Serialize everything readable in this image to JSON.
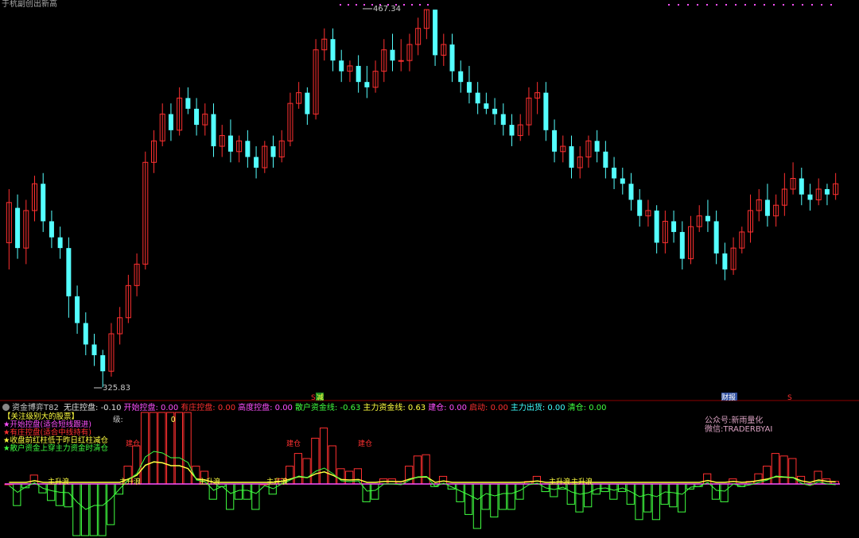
{
  "window": {
    "title": "于杭副创出新高"
  },
  "price_labels": {
    "high": "467.34",
    "low": "325.83"
  },
  "markers": {
    "jian": "减",
    "s1": "S",
    "s2": "S",
    "caibao": "财报"
  },
  "indicator": {
    "name": "资金博弈T82",
    "items": [
      {
        "label": "无庄控盘:",
        "value": "-0.10",
        "color": "#e0e0e0"
      },
      {
        "label": "开始控盘:",
        "value": "0.00",
        "color": "#ff50ff"
      },
      {
        "label": "有庄控盘:",
        "value": "0.00",
        "color": "#ff3030"
      },
      {
        "label": "高度控盘:",
        "value": "0.00",
        "color": "#ff50ff"
      },
      {
        "label": "散户资金线:",
        "value": "-0.63",
        "color": "#40ff40"
      },
      {
        "label": "主力资金线:",
        "value": "0.63",
        "color": "#ffff40"
      },
      {
        "label": "建仓:",
        "value": "0.00",
        "color": "#ff50ff"
      },
      {
        "label": "启动:",
        "value": "0.00",
        "color": "#ff3030"
      },
      {
        "label": "主力出货:",
        "value": "0.00",
        "color": "#40ffff"
      },
      {
        "label": "清仓:",
        "value": "0.00",
        "color": "#40ff40"
      }
    ]
  },
  "legend": [
    {
      "text": "【关注级别大的股票】",
      "color": "#ffff40"
    },
    {
      "text": "★开始控盘(适合短线跟进)",
      "color": "#ff50ff"
    },
    {
      "text": "★有庄控盘(适合中线持有)",
      "color": "#ff3030"
    },
    {
      "text": "★收盘前红柱低于昨日红柱减仓",
      "color": "#ffff40"
    },
    {
      "text": "★散户资金上穿主力资金时清仓",
      "color": "#40ff40"
    }
  ],
  "ji": {
    "label": "级:",
    "value": "0"
  },
  "watermark": {
    "line1": "公众号:新雨量化",
    "line2": "微信:TRADERBYAI"
  },
  "signals": {
    "zsj": "主升浪",
    "jc": "建仓"
  },
  "colors": {
    "up": "#ff3030",
    "down": "#54ffff",
    "vol_up": "#ff3030",
    "vol_down": "#40ff40",
    "main_line": "#ffff40",
    "retail_line": "#40ff40",
    "level_line": "#ff50ff"
  },
  "chart_data": {
    "type": "candlestick",
    "title": "",
    "ylim": [
      325.83,
      467.34
    ],
    "candles": [
      [
        380,
        395,
        370,
        400
      ],
      [
        393,
        378,
        374,
        398
      ],
      [
        378,
        392,
        372,
        396
      ],
      [
        392,
        402,
        388,
        405
      ],
      [
        402,
        388,
        384,
        406
      ],
      [
        388,
        382,
        378,
        392
      ],
      [
        382,
        378,
        374,
        386
      ],
      [
        378,
        360,
        352,
        382
      ],
      [
        360,
        350,
        346,
        364
      ],
      [
        350,
        342,
        338,
        354
      ],
      [
        342,
        338,
        334,
        346
      ],
      [
        338,
        332,
        326,
        340
      ],
      [
        332,
        346,
        330,
        350
      ],
      [
        346,
        352,
        342,
        356
      ],
      [
        352,
        364,
        350,
        368
      ],
      [
        364,
        372,
        360,
        376
      ],
      [
        372,
        410,
        370,
        414
      ],
      [
        410,
        418,
        406,
        422
      ],
      [
        418,
        428,
        416,
        432
      ],
      [
        428,
        422,
        418,
        432
      ],
      [
        422,
        434,
        420,
        438
      ],
      [
        434,
        430,
        428,
        438
      ],
      [
        430,
        424,
        420,
        434
      ],
      [
        424,
        428,
        420,
        432
      ],
      [
        428,
        416,
        412,
        432
      ],
      [
        416,
        420,
        412,
        424
      ],
      [
        420,
        414,
        410,
        426
      ],
      [
        414,
        418,
        410,
        420
      ],
      [
        418,
        412,
        408,
        422
      ],
      [
        412,
        408,
        404,
        416
      ],
      [
        408,
        416,
        406,
        418
      ],
      [
        416,
        412,
        408,
        420
      ],
      [
        412,
        418,
        410,
        422
      ],
      [
        418,
        432,
        416,
        436
      ],
      [
        432,
        436,
        430,
        440
      ],
      [
        436,
        428,
        424,
        438
      ],
      [
        428,
        452,
        426,
        456
      ],
      [
        452,
        456,
        448,
        460
      ],
      [
        456,
        448,
        444,
        460
      ],
      [
        448,
        444,
        440,
        452
      ],
      [
        444,
        446,
        440,
        448
      ],
      [
        446,
        440,
        436,
        450
      ],
      [
        440,
        438,
        434,
        446
      ],
      [
        438,
        444,
        436,
        448
      ],
      [
        444,
        452,
        440,
        456
      ],
      [
        452,
        448,
        444,
        458
      ],
      [
        448,
        448,
        444,
        456
      ],
      [
        448,
        454,
        444,
        458
      ],
      [
        454,
        460,
        450,
        464
      ],
      [
        460,
        467,
        456,
        467
      ],
      [
        467,
        450,
        446,
        467
      ],
      [
        450,
        454,
        446,
        458
      ],
      [
        454,
        444,
        440,
        458
      ],
      [
        444,
        440,
        436,
        448
      ],
      [
        440,
        436,
        432,
        446
      ],
      [
        436,
        432,
        428,
        440
      ],
      [
        432,
        430,
        428,
        436
      ],
      [
        430,
        428,
        424,
        434
      ],
      [
        428,
        424,
        420,
        432
      ],
      [
        424,
        420,
        416,
        428
      ],
      [
        420,
        424,
        418,
        428
      ],
      [
        424,
        434,
        420,
        438
      ],
      [
        434,
        436,
        428,
        440
      ],
      [
        436,
        422,
        418,
        440
      ],
      [
        422,
        414,
        410,
        426
      ],
      [
        414,
        416,
        410,
        420
      ],
      [
        416,
        408,
        404,
        420
      ],
      [
        408,
        412,
        404,
        416
      ],
      [
        412,
        418,
        408,
        420
      ],
      [
        418,
        414,
        410,
        422
      ],
      [
        414,
        408,
        404,
        418
      ],
      [
        408,
        404,
        400,
        412
      ],
      [
        404,
        402,
        398,
        408
      ],
      [
        402,
        396,
        392,
        406
      ],
      [
        396,
        390,
        386,
        400
      ],
      [
        390,
        392,
        386,
        396
      ],
      [
        392,
        380,
        376,
        394
      ],
      [
        380,
        388,
        376,
        392
      ],
      [
        388,
        384,
        380,
        392
      ],
      [
        384,
        374,
        370,
        388
      ],
      [
        374,
        386,
        372,
        390
      ],
      [
        386,
        390,
        384,
        394
      ],
      [
        390,
        388,
        384,
        396
      ],
      [
        388,
        376,
        372,
        392
      ],
      [
        376,
        370,
        366,
        380
      ],
      [
        370,
        378,
        368,
        382
      ],
      [
        378,
        384,
        376,
        386
      ],
      [
        384,
        392,
        380,
        398
      ],
      [
        392,
        396,
        388,
        400
      ],
      [
        396,
        390,
        386,
        402
      ],
      [
        390,
        394,
        386,
        398
      ],
      [
        394,
        400,
        390,
        406
      ],
      [
        400,
        404,
        398,
        410
      ],
      [
        404,
        398,
        394,
        408
      ],
      [
        398,
        396,
        392,
        402
      ],
      [
        396,
        400,
        394,
        404
      ],
      [
        400,
        398,
        394,
        402
      ],
      [
        398,
        402,
        396,
        406
      ]
    ]
  }
}
